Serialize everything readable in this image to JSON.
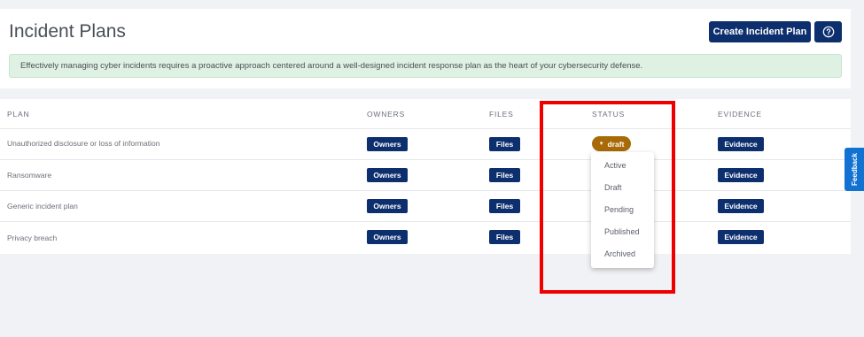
{
  "header": {
    "title": "Incident Plans",
    "create_button": "Create Incident Plan",
    "help_icon": "question-circle-icon",
    "banner": "Effectively managing cyber incidents requires a proactive approach centered around a well-designed incident response plan as the heart of your cybersecurity defense."
  },
  "table": {
    "columns": [
      "PLAN",
      "OWNERS",
      "FILES",
      "STATUS",
      "EVIDENCE"
    ],
    "rows": [
      {
        "plan": "Unauthorized disclosure or loss of information",
        "owners": "Owners",
        "files": "Files",
        "status": "draft",
        "evidence": "Evidence"
      },
      {
        "plan": "Ransomware",
        "owners": "Owners",
        "files": "Files",
        "evidence": "Evidence"
      },
      {
        "plan": "Generic incident plan",
        "owners": "Owners",
        "files": "Files",
        "evidence": "Evidence"
      },
      {
        "plan": "Privacy breach",
        "owners": "Owners",
        "files": "Files",
        "evidence": "Evidence"
      }
    ]
  },
  "status_dropdown": {
    "options": [
      "Active",
      "Draft",
      "Pending",
      "Published",
      "Archived"
    ]
  },
  "feedback_tab": "Feedback",
  "colors": {
    "primary": "#0d2f6e",
    "draft_badge": "#a86a06",
    "banner_bg": "#dff1e3",
    "highlight": "#ee0000",
    "feedback": "#1272d1"
  }
}
